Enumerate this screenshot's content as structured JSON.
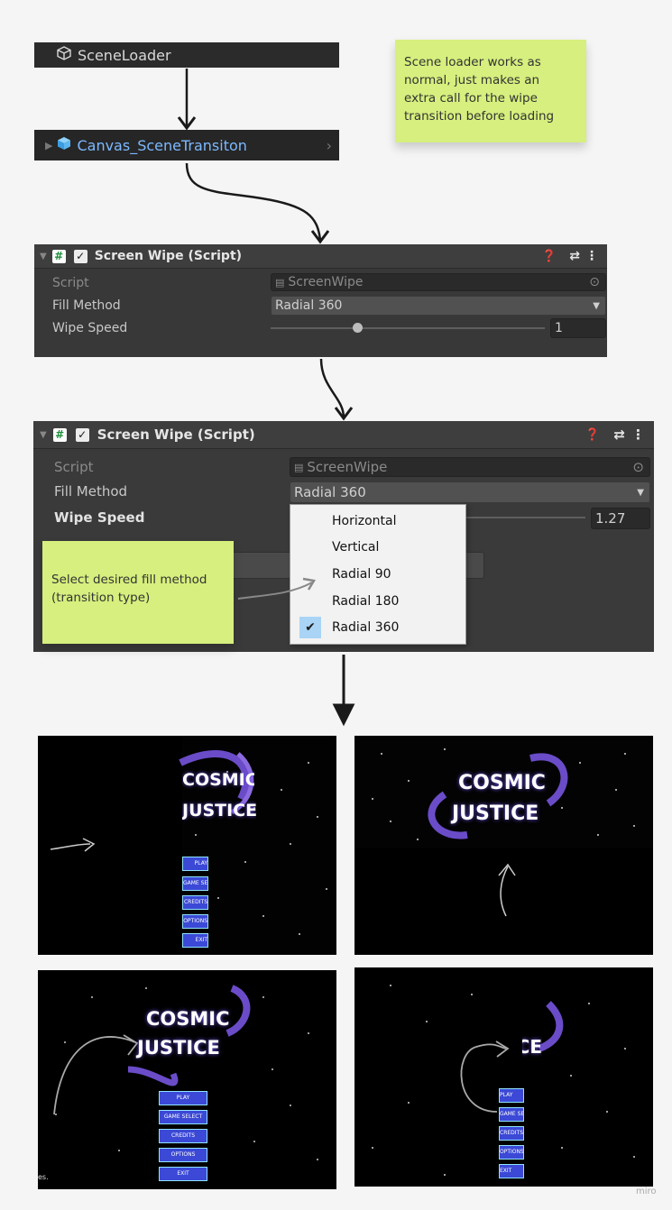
{
  "scene_loader": {
    "label": "SceneLoader"
  },
  "canvas_transition": {
    "label": "Canvas_SceneTransiton"
  },
  "note_top": {
    "text": "Scene loader works as normal, just makes an extra call for the wipe transition before loading"
  },
  "component1": {
    "title": "Screen Wipe (Script)",
    "script_label": "Script",
    "script_value": "ScreenWipe",
    "fill_label": "Fill Method",
    "fill_value": "Radial 360",
    "speed_label": "Wipe Speed",
    "speed_value": "1",
    "slider_fraction": 0.32
  },
  "component2": {
    "title": "Screen Wipe (Script)",
    "script_label": "Script",
    "script_value": "ScreenWipe",
    "fill_label": "Fill Method",
    "fill_value": "Radial 360",
    "speed_label": "Wipe Speed",
    "speed_value": "1.27",
    "dropdown_options": [
      "Horizontal",
      "Vertical",
      "Radial 90",
      "Radial 180",
      "Radial 360"
    ],
    "selected_option": "Radial 360"
  },
  "note_bottom": {
    "text": "Select desired fill method (transition type)"
  },
  "screenshots": {
    "logo_line1": "COSMIC",
    "logo_line2": "JUSTICE",
    "menu_buttons": [
      "PLAY",
      "GAME SELECT",
      "CREDITS",
      "OPTIONS",
      "EXIT"
    ]
  },
  "watermark": {
    "text": "miro"
  },
  "colors": {
    "sticky": "#d6ef7e",
    "panel": "#383838",
    "selected_item": "#a9d4f5",
    "logo": "#7a55d6"
  }
}
